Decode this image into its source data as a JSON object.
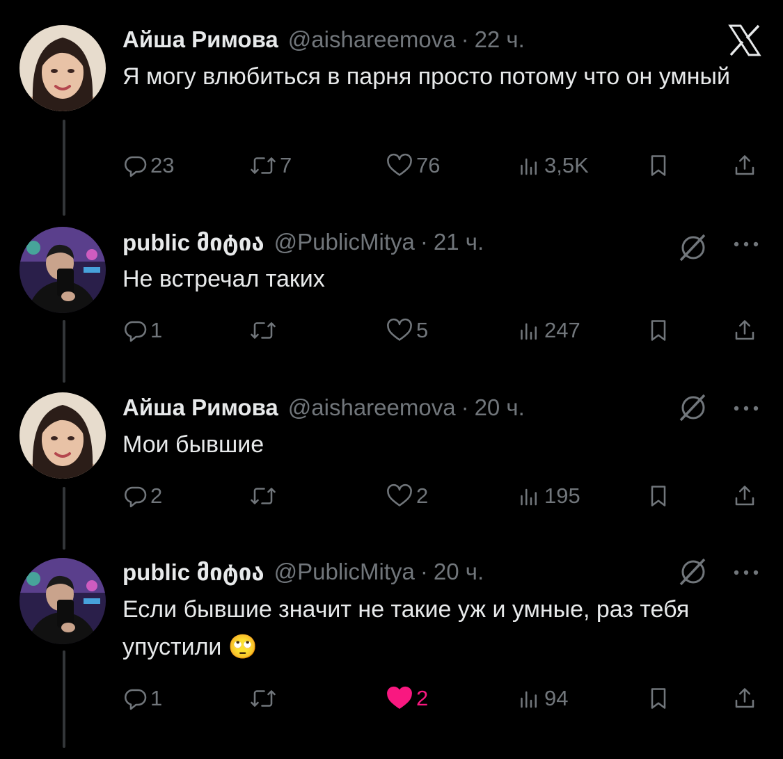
{
  "tweets": [
    {
      "author": "Айша Римова",
      "handle": "@aishareemova",
      "time": "22 ч.",
      "text": "Я могу влюбиться в парня просто потому что он умный",
      "replies": "23",
      "reposts": "7",
      "likes": "76",
      "views": "3,5K",
      "liked": false
    },
    {
      "author": "public მიტია",
      "handle": "@PublicMitya",
      "time": "21 ч.",
      "text": "Не встречал таких",
      "replies": "1",
      "reposts": "",
      "likes": "5",
      "views": "247",
      "liked": false
    },
    {
      "author": "Айша Римова",
      "handle": "@aishareemova",
      "time": "20 ч.",
      "text": "Мои бывшие",
      "replies": "2",
      "reposts": "",
      "likes": "2",
      "views": "195",
      "liked": false
    },
    {
      "author": "public მიტია",
      "handle": "@PublicMitya",
      "time": "20 ч.",
      "text": "Если бывшие значит не такие уж и умные, раз тебя упустили 🙄",
      "replies": "1",
      "reposts": "",
      "likes": "2",
      "views": "94",
      "liked": true
    }
  ],
  "separator": "·",
  "icons": {
    "brand": "x-logo-icon",
    "ai": "grok-icon",
    "more": "more-icon",
    "reply": "reply-icon",
    "repost": "repost-icon",
    "like": "heart-icon",
    "views": "views-icon",
    "bookmark": "bookmark-icon",
    "share": "share-icon"
  },
  "colors": {
    "background": "#000000",
    "text": "#e7e9ea",
    "muted": "#71767b",
    "like": "#f91880",
    "thread_line": "#333639"
  }
}
